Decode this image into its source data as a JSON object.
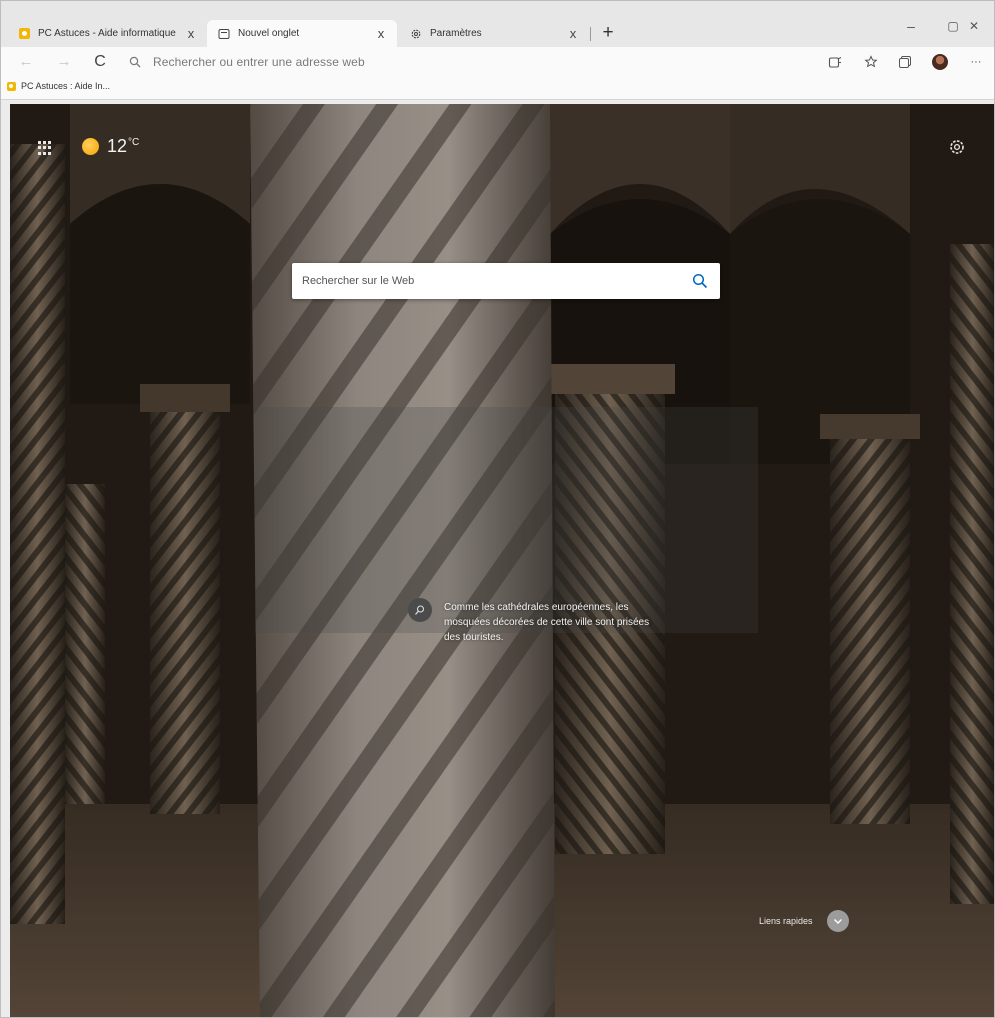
{
  "tabs": [
    {
      "label": "PC Astuces - Aide informatique",
      "close": "x",
      "icon": "pc-astuces-favicon",
      "active": false
    },
    {
      "label": "Nouvel onglet",
      "close": "x",
      "icon": "new-tab-page-icon",
      "active": true
    },
    {
      "label": "Paramètres",
      "close": "x",
      "icon": "settings-gear-icon",
      "active": false
    }
  ],
  "new_tab_symbol": "+",
  "window_controls": {
    "minimize": "–",
    "maximize": "▢",
    "close": "✕"
  },
  "toolbar": {
    "back": "←",
    "forward": "→",
    "refresh": "C",
    "address_placeholder": "Rechercher ou entrer une adresse web",
    "more": "···"
  },
  "favorites_bar": {
    "items": [
      {
        "label": "PC Astuces : Aide In..."
      }
    ]
  },
  "new_tab_page": {
    "weather": {
      "temperature": "12",
      "unit": "°C",
      "icon": "sun-icon"
    },
    "search": {
      "placeholder": "Rechercher sur le Web"
    },
    "image_caption": "Comme les cathédrales européennes, les mosquées décorées de cette ville sont prisées des touristes.",
    "quick_links": "Liens rapides"
  },
  "colors": {
    "accent": "#0067c0",
    "weather_sun": "#f5a100",
    "tab_bar": "#e7e7e7"
  }
}
